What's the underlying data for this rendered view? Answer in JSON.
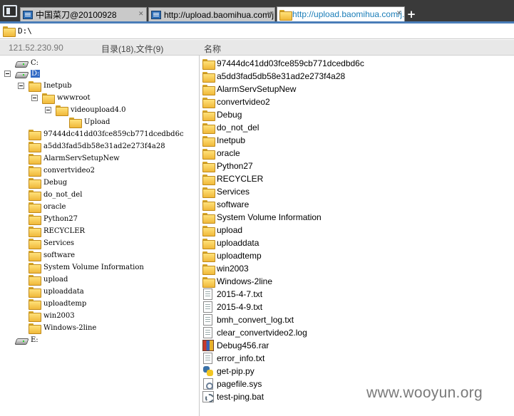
{
  "tabs": [
    {
      "label": "中国菜刀@20100928",
      "icon": "window-icon"
    },
    {
      "label": "http://upload.baomihua.com/j...",
      "icon": "window-icon"
    },
    {
      "label": "http://upload.baomihua.com/j...",
      "icon": "folder-icon",
      "active": true
    }
  ],
  "add_tab_label": "+",
  "path": "D:\\",
  "header": {
    "ip": "121.52.230.90",
    "counts": "目录(18),文件(9)",
    "name_col": "名称"
  },
  "tree": {
    "drives": [
      "C:",
      "D:",
      "E:"
    ],
    "nodes": [
      "Inetpub",
      "wwwroot",
      "videoupload4.0",
      "Upload"
    ],
    "d_children": [
      "97444dc41dd03fce859cb771dcedbd6c",
      "a5dd3fad5db58e31ad2e273f4a28",
      "AlarmServSetupNew",
      "convertvideo2",
      "Debug",
      "do_not_del",
      "oracle",
      "Python27",
      "RECYCLER",
      "Services",
      "software",
      "System Volume Information",
      "upload",
      "uploaddata",
      "uploadtemp",
      "win2003",
      "Windows-2line"
    ]
  },
  "list": {
    "folders": [
      "97444dc41dd03fce859cb771dcedbd6c",
      "a5dd3fad5db58e31ad2e273f4a28",
      "AlarmServSetupNew",
      "convertvideo2",
      "Debug",
      "do_not_del",
      "Inetpub",
      "oracle",
      "Python27",
      "RECYCLER",
      "Services",
      "software",
      "System Volume Information",
      "upload",
      "uploaddata",
      "uploadtemp",
      "win2003",
      "Windows-2line"
    ],
    "files": [
      {
        "name": "2015-4-7.txt",
        "icon": "text-file-icon"
      },
      {
        "name": "2015-4-9.txt",
        "icon": "text-file-icon"
      },
      {
        "name": "bmh_convert_log.txt",
        "icon": "text-file-icon"
      },
      {
        "name": "clear_convertvideo2.log",
        "icon": "text-file-icon"
      },
      {
        "name": "Debug456.rar",
        "icon": "rar-archive-icon"
      },
      {
        "name": "error_info.txt",
        "icon": "text-file-icon"
      },
      {
        "name": "get-pip.py",
        "icon": "python-file-icon"
      },
      {
        "name": "pagefile.sys",
        "icon": "system-file-icon"
      },
      {
        "name": "test-ping.bat",
        "icon": "batch-file-icon"
      }
    ]
  },
  "watermark": "www.wooyun.org",
  "colors": {
    "tab_active_text": "#1a7db8",
    "selection": "#316ac5",
    "tabbar_bg": "#3a3a3a",
    "accent_bar": "#4a7db8"
  }
}
